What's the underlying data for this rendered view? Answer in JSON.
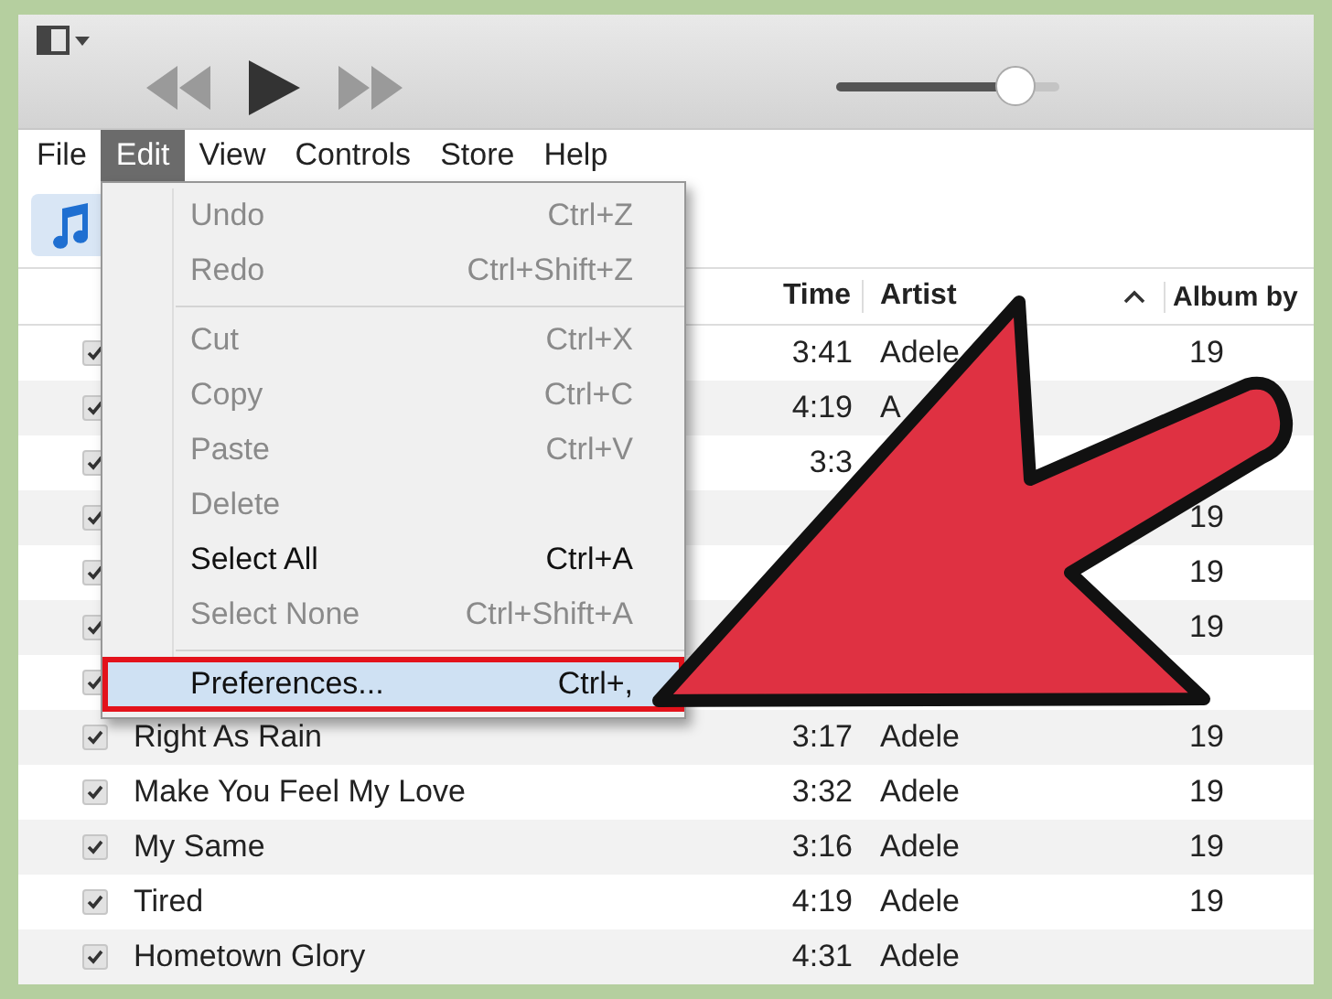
{
  "player": {
    "volume": {
      "level": 0.8
    }
  },
  "menu_bar": [
    {
      "label": "File",
      "selected": false
    },
    {
      "label": "Edit",
      "selected": true
    },
    {
      "label": "View",
      "selected": false
    },
    {
      "label": "Controls",
      "selected": false
    },
    {
      "label": "Store",
      "selected": false
    },
    {
      "label": "Help",
      "selected": false
    }
  ],
  "table": {
    "columns": [
      {
        "label": "Time",
        "kind": "time"
      },
      {
        "label": "Artist",
        "kind": "artist"
      },
      {
        "label": "Album by",
        "kind": "album"
      }
    ],
    "rows": [
      {
        "checked": true,
        "time": "3:41",
        "artist": "Adele",
        "album": "19"
      },
      {
        "checked": true,
        "time": "4:19",
        "artist": "A"
      },
      {
        "checked": true,
        "time": "3:3"
      },
      {
        "checked": true,
        "album": "19"
      },
      {
        "checked": true,
        "album": "19"
      },
      {
        "checked": true,
        "album": "19"
      },
      {
        "checked": true
      },
      {
        "checked": true,
        "title": "Right As Rain",
        "time": "3:17",
        "artist": "Adele",
        "album": "19"
      },
      {
        "checked": true,
        "title": "Make You Feel My Love",
        "time": "3:32",
        "artist": "Adele",
        "album": "19"
      },
      {
        "checked": true,
        "title": "My Same",
        "time": "3:16",
        "artist": "Adele",
        "album": "19"
      },
      {
        "checked": true,
        "title": "Tired",
        "time": "4:19",
        "artist": "Adele",
        "album": "19"
      },
      {
        "checked": true,
        "title": "Hometown Glory",
        "time": "4:31",
        "artist": "Adele"
      }
    ]
  },
  "edit_menu": {
    "items": [
      {
        "kind": "item",
        "label": "Undo",
        "shortcut": "Ctrl+Z",
        "disabled": true,
        "selected": false,
        "outlined": false
      },
      {
        "kind": "item",
        "label": "Redo",
        "shortcut": "Ctrl+Shift+Z",
        "disabled": true,
        "selected": false,
        "outlined": false
      },
      {
        "kind": "separator"
      },
      {
        "kind": "item",
        "label": "Cut",
        "shortcut": "Ctrl+X",
        "disabled": true,
        "selected": false,
        "outlined": false
      },
      {
        "kind": "item",
        "label": "Copy",
        "shortcut": "Ctrl+C",
        "disabled": true,
        "selected": false,
        "outlined": false
      },
      {
        "kind": "item",
        "label": "Paste",
        "shortcut": "Ctrl+V",
        "disabled": true,
        "selected": false,
        "outlined": false
      },
      {
        "kind": "item",
        "label": "Delete",
        "disabled": true,
        "selected": false,
        "outlined": false
      },
      {
        "kind": "item",
        "label": "Select All",
        "shortcut": "Ctrl+A",
        "disabled": false,
        "selected": false,
        "outlined": false
      },
      {
        "kind": "item",
        "label": "Select None",
        "shortcut": "Ctrl+Shift+A",
        "disabled": true,
        "selected": false,
        "outlined": false
      },
      {
        "kind": "separator"
      },
      {
        "kind": "item",
        "label": "Preferences...",
        "shortcut": "Ctrl+,",
        "disabled": false,
        "selected": true,
        "outlined": true
      }
    ]
  }
}
